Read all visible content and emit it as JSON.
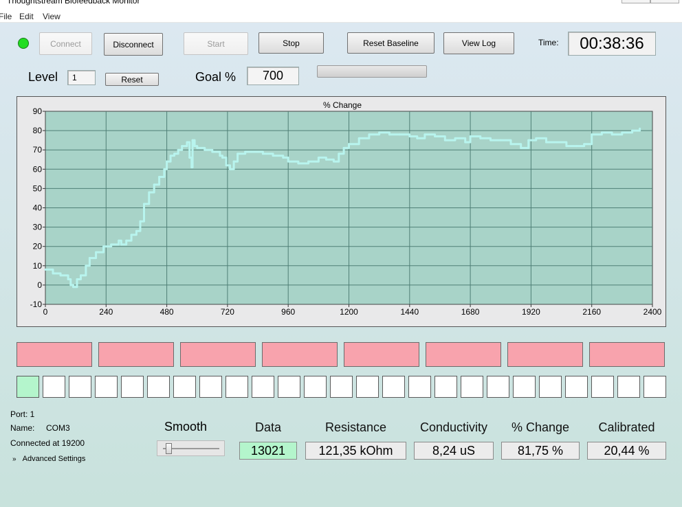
{
  "window": {
    "title": "Thoughtstream Biofeedback Monitor"
  },
  "menu": [
    "File",
    "Edit",
    "View"
  ],
  "toolbar": {
    "connect": "Connect",
    "disconnect": "Disconnect",
    "start": "Start",
    "stop": "Stop",
    "reset_baseline": "Reset Baseline",
    "view_log": "View Log",
    "time_label": "Time:",
    "time_value": "00:38:36",
    "status_color": "#22dd22"
  },
  "level": {
    "label": "Level",
    "value": "1",
    "reset": "Reset"
  },
  "goal": {
    "label": "Goal %",
    "value": "700"
  },
  "chart_data": {
    "type": "line",
    "title": "% Change",
    "xlim": [
      0,
      2400
    ],
    "ylim": [
      -10,
      90
    ],
    "x_ticks": [
      "0",
      "240",
      "480",
      "720",
      "960",
      "1200",
      "1440",
      "1680",
      "1920",
      "2160",
      "2400"
    ],
    "y_ticks": [
      "90",
      "80",
      "70",
      "60",
      "50",
      "40",
      "30",
      "20",
      "10",
      "0",
      "-10"
    ],
    "grid": true,
    "series_color": "#b8f4ee",
    "x": [
      0,
      30,
      60,
      90,
      100,
      110,
      125,
      140,
      160,
      175,
      200,
      230,
      260,
      290,
      300,
      320,
      340,
      360,
      375,
      390,
      410,
      430,
      450,
      470,
      480,
      495,
      510,
      525,
      540,
      560,
      570,
      578,
      582,
      590,
      600,
      630,
      660,
      690,
      700,
      715,
      730,
      745,
      760,
      790,
      820,
      860,
      900,
      940,
      960,
      1000,
      1040,
      1080,
      1110,
      1140,
      1160,
      1180,
      1200,
      1240,
      1280,
      1320,
      1360,
      1400,
      1440,
      1470,
      1500,
      1540,
      1580,
      1620,
      1660,
      1680,
      1720,
      1760,
      1800,
      1840,
      1880,
      1910,
      1940,
      1980,
      2020,
      2060,
      2100,
      2130,
      2160,
      2200,
      2240,
      2280,
      2320,
      2350
    ],
    "values": [
      8,
      6,
      5,
      3,
      0,
      -1,
      3,
      5,
      10,
      14,
      17,
      20,
      21,
      23,
      21,
      23,
      26,
      28,
      33,
      42,
      48,
      52,
      56,
      60,
      64,
      67,
      68,
      70,
      72,
      74,
      66,
      61,
      75,
      72,
      71,
      70,
      69,
      67,
      66,
      62,
      60,
      64,
      68,
      69,
      69,
      68,
      67,
      66,
      64,
      63,
      64,
      66,
      65,
      64,
      68,
      71,
      73,
      76,
      78,
      79,
      78,
      78,
      77,
      76,
      78,
      77,
      75,
      76,
      74,
      77,
      76,
      75,
      75,
      73,
      71,
      75,
      76,
      74,
      74,
      72,
      72,
      73,
      78,
      79,
      78,
      79,
      80,
      81
    ],
    "annotations": []
  },
  "zones": 8,
  "cells": 25,
  "active_cells": 1,
  "zone_color": "#f8a3ad",
  "cell_on_color": "#b4f5cc",
  "port": {
    "port": "Port:   1",
    "name_label": "Name:",
    "name_value": "COM3",
    "connected": "Connected at 19200",
    "advanced": "Advanced Settings"
  },
  "smooth": {
    "label": "Smooth",
    "value_fraction": 0.05
  },
  "readouts": {
    "data": {
      "label": "Data",
      "value": "13021"
    },
    "resistance": {
      "label": "Resistance",
      "value": "121,35 kOhm"
    },
    "conductivity": {
      "label": "Conductivity",
      "value": "8,24 uS"
    },
    "pct_change": {
      "label": "% Change",
      "value": "81,75 %"
    },
    "calibrated": {
      "label": "Calibrated",
      "value": "20,44 %"
    }
  },
  "data_highlight_color": "#b4f5cc"
}
